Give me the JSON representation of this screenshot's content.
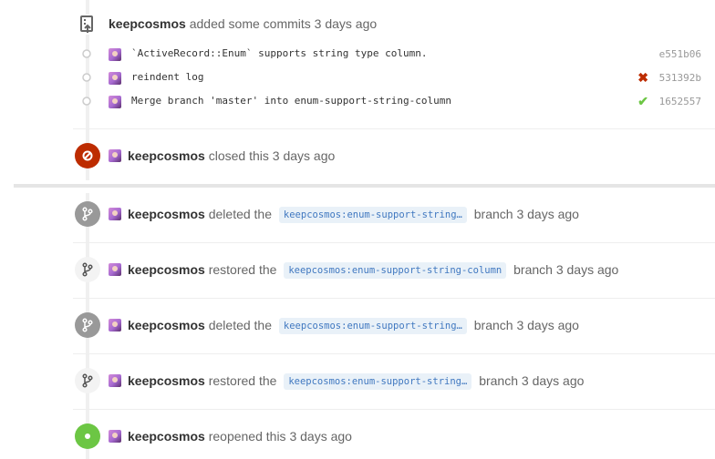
{
  "commits_header": {
    "user": "keepcosmos",
    "action": "added some commits",
    "time": "3 days ago"
  },
  "commits": [
    {
      "message": "`ActiveRecord::Enum` supports string type column.",
      "sha": "e551b06",
      "status": "none"
    },
    {
      "message": "reindent log",
      "sha": "531392b",
      "status": "failure"
    },
    {
      "message": "Merge branch 'master' into enum-support-string-column",
      "sha": "1652557",
      "status": "success"
    }
  ],
  "events": [
    {
      "icon": "closed-icon",
      "user": "keepcosmos",
      "action": "closed this",
      "time": "3 days ago"
    },
    {
      "icon": "git-branch-icon",
      "user": "keepcosmos",
      "action": "deleted the",
      "branch": "keepcosmos:enum-support-string…",
      "suffix": "branch",
      "time": "3 days ago"
    },
    {
      "icon": "git-branch-icon",
      "user": "keepcosmos",
      "action": "restored the",
      "branch": "keepcosmos:enum-support-string-column",
      "suffix": "branch",
      "time": "3 days ago"
    },
    {
      "icon": "git-branch-icon",
      "user": "keepcosmos",
      "action": "deleted the",
      "branch": "keepcosmos:enum-support-string…",
      "suffix": "branch",
      "time": "3 days ago"
    },
    {
      "icon": "git-branch-icon",
      "user": "keepcosmos",
      "action": "restored the",
      "branch": "keepcosmos:enum-support-string…",
      "suffix": "branch",
      "time": "3 days ago"
    },
    {
      "icon": "reopened-icon",
      "user": "keepcosmos",
      "action": "reopened this",
      "time": "3 days ago"
    }
  ],
  "colors": {
    "closed": "#bd2c00",
    "reopened": "#6cc644",
    "branch_event": "#999999",
    "failure": "#bd2c00",
    "success": "#6cc644"
  }
}
